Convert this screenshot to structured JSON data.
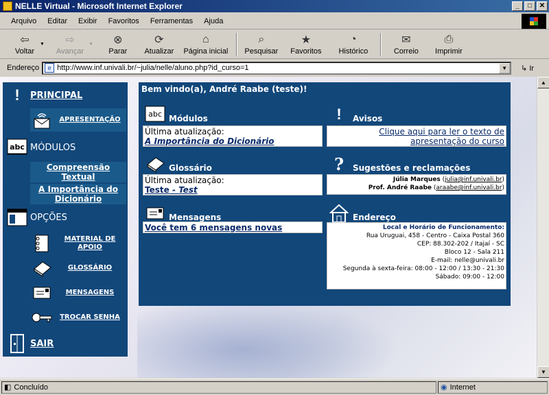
{
  "window": {
    "title": "NELLE Virtual - Microsoft Internet Explorer",
    "btn_min": "_",
    "btn_max": "□",
    "btn_close": "✕"
  },
  "menu": [
    "Arquivo",
    "Editar",
    "Exibir",
    "Favoritos",
    "Ferramentas",
    "Ajuda"
  ],
  "toolbar": {
    "back": "Voltar",
    "forward": "Avançar",
    "stop": "Parar",
    "refresh": "Atualizar",
    "home": "Página inicial",
    "search": "Pesquisar",
    "favorites": "Favoritos",
    "history": "Histórico",
    "mail": "Correio",
    "print": "Imprimir",
    "dropdown_glyph": "▼"
  },
  "address": {
    "label": "Endereço",
    "url": "http://www.inf.univali.br/~julia/nelle/aluno.php?id_curso=1",
    "go": "Ir",
    "dropdown_glyph": "▼"
  },
  "sidebar": {
    "principal": "PRINCIPAL",
    "apresentacao": "APRESENTAÇÃO",
    "modulos": "MÓDULOS",
    "modulo_links": [
      "Compreensão Textual",
      "A Importância do Dicionário"
    ],
    "opcoes": "OPÇÕES",
    "options": [
      "MATERIAL DE APOIO",
      "GLOSSÁRIO",
      "MENSAGENS",
      "TROCAR SENHA"
    ],
    "sair": "SAIR"
  },
  "main": {
    "welcome": "Bem vindo(a), André Raabe (teste)!",
    "modulos": {
      "title": "Módulos",
      "label": "Última atualização:",
      "link": "A Importância do Dicionário"
    },
    "glossario": {
      "title": "Glossário",
      "label": "Última atualização:",
      "term": "Teste",
      "sep": " - ",
      "def": "Test"
    },
    "mensagens": {
      "title": "Mensagens",
      "link": "Você tem 6 mensagens novas"
    },
    "avisos": {
      "title": "Avisos",
      "link": "Clique aqui para ler o texto de apresentação do curso"
    },
    "sugestoes": {
      "title": "Sugestões e reclamações",
      "contacts": [
        {
          "name": "Júlia Marques",
          "email": "julia@inf.univali.br"
        },
        {
          "name": "Prof. André Raabe",
          "email": "araabe@inf.univali.br"
        }
      ]
    },
    "endereco": {
      "title": "Endereço",
      "heading": "Local e Horário de Funcionamento:",
      "lines": [
        "Rua Uruguai, 458 - Centro - Caixa Postal 360",
        "CEP: 88.302-202 / Itajaí - SC",
        "Bloco 12 - Sala 211",
        "E-mail: nelle@univali.br",
        "Segunda à sexta-feira: 08:00 - 12:00 / 13:30 - 21:30",
        "Sábado: 09:00 - 12:00"
      ]
    }
  },
  "status": {
    "left": "Concluído",
    "zone": "Internet"
  }
}
